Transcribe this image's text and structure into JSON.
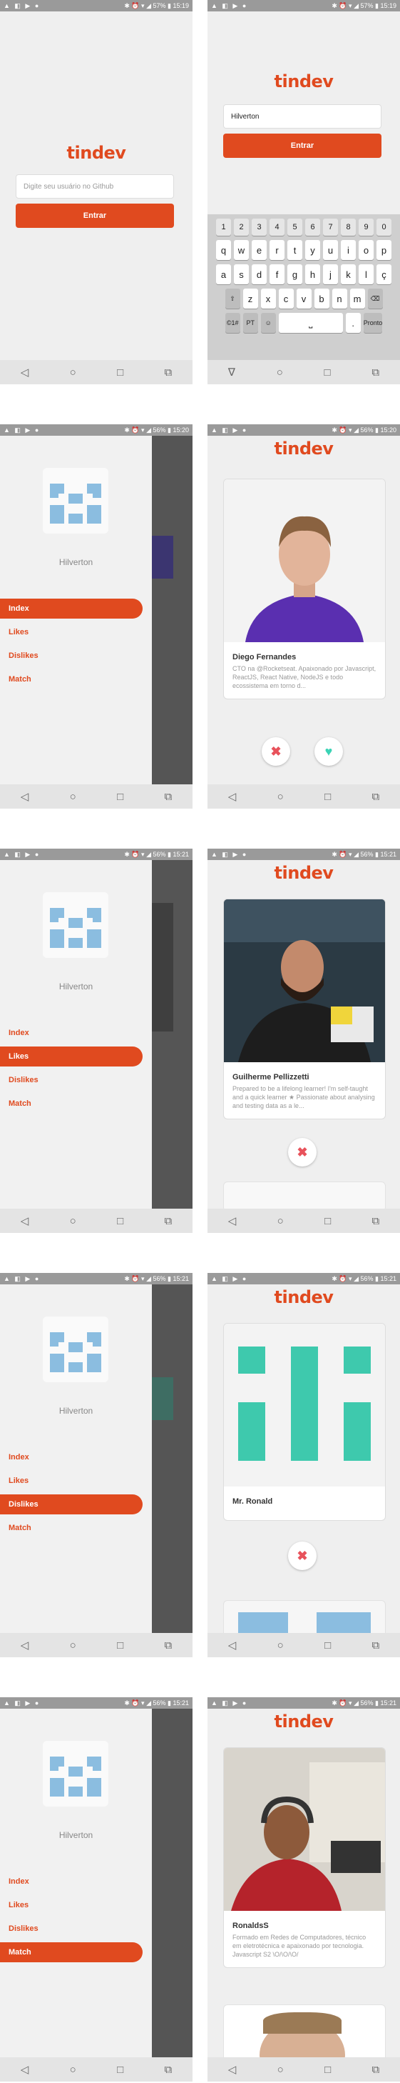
{
  "colors": {
    "brand": "#e04a1f",
    "dislike": "#e8525b",
    "like": "#3ad3b5"
  },
  "app": {
    "logo": "tindev"
  },
  "nav": {
    "back": "◁",
    "home": "○",
    "recents": "□",
    "extra": "⧉"
  },
  "status": {
    "s1": {
      "icons": "▲ ◧ ▶ ●",
      "right": "✱ ⏰ ▾ ◢ 57% ▮ 15:19"
    },
    "s2": {
      "icons": "▲ ◧ ▶ ●",
      "right": "✱ ⏰ ▾ ◢ 57% ▮ 15:19"
    },
    "s3": {
      "icons": "▲ ◧ ▶ ●",
      "right": "✱ ⏰ ▾ ◢ 56% ▮ 15:20"
    },
    "s4": {
      "icons": "▲ ◧ ▶ ●",
      "right": "✱ ⏰ ▾ ◢ 56% ▮ 15:20"
    },
    "s5": {
      "icons": "▲ ◧ ▶ ●",
      "right": "✱ ⏰ ▾ ◢ 56% ▮ 15:21"
    },
    "s6": {
      "icons": "▲ ◧ ▶ ●",
      "right": "✱ ⏰ ▾ ◢ 56% ▮ 15:21"
    },
    "s7": {
      "icons": "▲ ◧ ▶ ●",
      "right": "✱ ⏰ ▾ ◢ 56% ▮ 15:21"
    },
    "s8": {
      "icons": "▲ ◧ ▶ ●",
      "right": "✱ ⏰ ▾ ◢ 56% ▮ 15:21"
    },
    "s9": {
      "icons": "▲ ◧ ▶ ●",
      "right": "✱ ⏰ ▾ ◢ 56% ▮ 15:21"
    },
    "s10": {
      "icons": "▲ ◧ ▶ ●",
      "right": "✱ ⏰ ▾ ◢ 56% ▮ 15:21"
    }
  },
  "login": {
    "placeholder": "Digite seu usuário no Github",
    "value": "Hilverton",
    "submit": "Entrar"
  },
  "keyboard": {
    "numbers": [
      "1",
      "2",
      "3",
      "4",
      "5",
      "6",
      "7",
      "8",
      "9",
      "0"
    ],
    "row1": [
      "q",
      "w",
      "e",
      "r",
      "t",
      "y",
      "u",
      "i",
      "o",
      "p"
    ],
    "row2": [
      "a",
      "s",
      "d",
      "f",
      "g",
      "h",
      "j",
      "k",
      "l",
      "ç"
    ],
    "row3": [
      "⇧",
      "z",
      "x",
      "c",
      "v",
      "b",
      "n",
      "m",
      "⌫"
    ],
    "row4": [
      "©1#",
      "PT",
      "☺",
      "⎵",
      ".",
      "Pronto"
    ]
  },
  "drawer": {
    "user": "Hilverton",
    "menu": [
      "Index",
      "Likes",
      "Dislikes",
      "Match"
    ]
  },
  "cards": {
    "diego": {
      "name": "Diego Fernandes",
      "bio": "CTO na @Rocketseat. Apaixonado por Javascript, ReactJS, React Native, NodeJS e todo ecossistema em torno d..."
    },
    "guilherme": {
      "name": "Guilherme Pellizzetti",
      "bio": "Prepared to be a lifelong learner! I'm self-taught and a quick learner ★ Passionate about analysing and testing data as a le..."
    },
    "ronald": {
      "name": "Mr. Ronald",
      "bio": ""
    },
    "ronaldss": {
      "name": "RonaldsS",
      "bio": "Formado em Redes de Computadores, técnico em eletrotécnica e apaixonado por tecnologia. Javascript S2 \\O/\\O/\\O/"
    }
  },
  "actions": {
    "dislike": "✖",
    "like": "♥"
  }
}
